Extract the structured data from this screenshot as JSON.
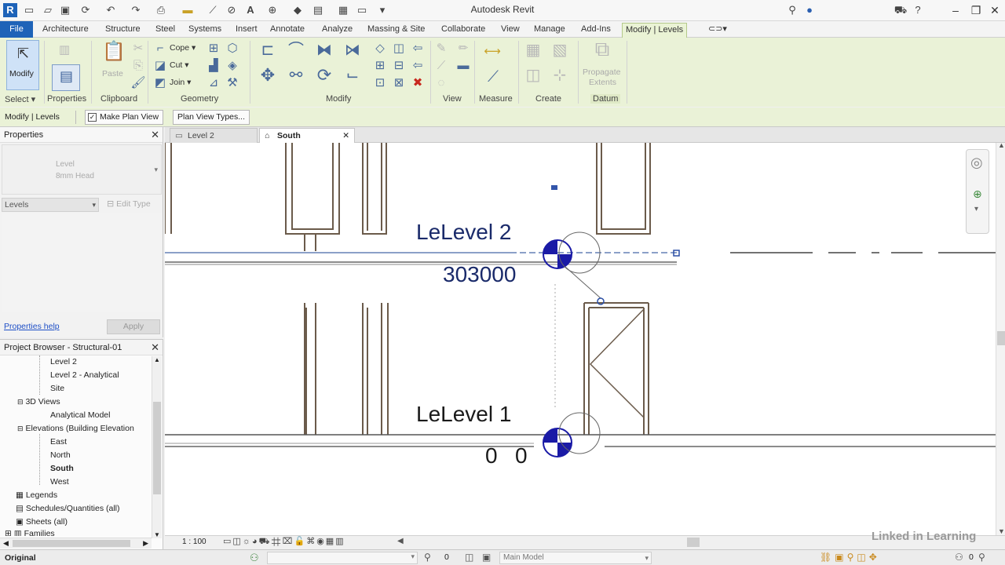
{
  "window": {
    "title": "Autodesk Revit"
  },
  "ribbon_tabs": [
    "File",
    "Architecture",
    "Structure",
    "Steel",
    "Systems",
    "Insert",
    "Annotate",
    "Analyze",
    "Massing & Site",
    "Collaborate",
    "View",
    "Manage",
    "Add-Ins",
    "Modify | Levels"
  ],
  "ribbon": {
    "modify_label": "Modify",
    "select_label": "Select",
    "properties_label": "Properties",
    "clipboard_label": "Clipboard",
    "paste_label": "Paste",
    "cope_label": "Cope",
    "cut_label": "Cut",
    "join_label": "Join",
    "geometry_label": "Geometry",
    "modify_panel_label": "Modify",
    "view_label": "View",
    "measure_label": "Measure",
    "create_label": "Create",
    "propagate_label_1": "Propagate",
    "propagate_label_2": "Extents",
    "datum_label": "Datum"
  },
  "options_bar": {
    "context_label": "Modify | Levels",
    "make_plan_view_label": "Make Plan View",
    "make_plan_view_checked": true,
    "plan_view_types_label": "Plan View Types..."
  },
  "properties": {
    "header": "Properties",
    "type_line1": "Level",
    "type_line2": "8mm Head",
    "filter": "Levels",
    "edit_type": "Edit Type",
    "help_link": "Properties help",
    "apply": "Apply"
  },
  "project_browser": {
    "header": "Project Browser - Structural-01",
    "items": [
      "Level 2",
      "Level 2 - Analytical",
      "Site",
      "3D Views",
      "Analytical Model",
      "Elevations (Building Elevation",
      "East",
      "North",
      "South",
      "West",
      "Legends",
      "Schedules/Quantities (all)",
      "Sheets (all)",
      "Families"
    ]
  },
  "view_tabs": [
    "Level 2",
    "South"
  ],
  "canvas": {
    "level2_name": "LeLevel 2",
    "level2_elev": "303000",
    "level1_name": "LeLevel 1",
    "level1_elev_a": "0",
    "level1_elev_b": "0"
  },
  "view_control": {
    "scale": "1 : 100"
  },
  "status_bar": {
    "text": "Original",
    "model": "Main Model",
    "counter": "0",
    "watermark": "Linked in Learning"
  },
  "colors": {
    "file_tab": "#1e63b8",
    "contextual_tab": "#eaf2d7",
    "level_head": "#1a1aa6"
  }
}
